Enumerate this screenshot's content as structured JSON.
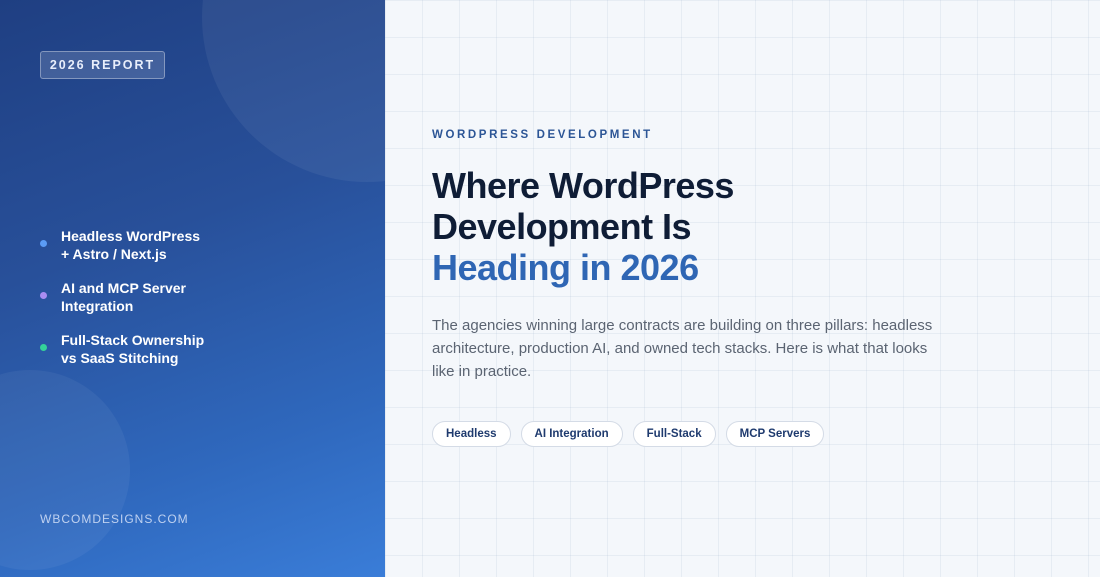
{
  "sidebar": {
    "badge": "2026 REPORT",
    "pillars": [
      {
        "line1": "Headless WordPress",
        "line2": "+ Astro / Next.js",
        "dot_color": "#5b9cf5"
      },
      {
        "line1": "AI and MCP Server",
        "line2": "Integration",
        "dot_color": "#a98df2"
      },
      {
        "line1": "Full-Stack Ownership",
        "line2": "vs SaaS Stitching",
        "dot_color": "#34d399"
      }
    ],
    "footer_url": "WBCOMDESIGNS.COM"
  },
  "main": {
    "eyebrow": "WORDPRESS DEVELOPMENT",
    "headline": {
      "line1": "Where WordPress",
      "line2": "Development Is",
      "line3_accent": "Heading in 2026"
    },
    "description": "The agencies winning large contracts are building on three pillars: headless architecture, production AI, and owned tech stacks. Here is what that looks like in practice.",
    "tags": [
      "Headless",
      "AI Integration",
      "Full-Stack",
      "MCP Servers"
    ]
  },
  "colors": {
    "panel_gradient_start": "#1f3f82",
    "panel_gradient_end": "#3a7dd8",
    "headline_dark": "#0f1d36",
    "headline_accent": "#2f66b4",
    "eyebrow": "#2c5596"
  }
}
